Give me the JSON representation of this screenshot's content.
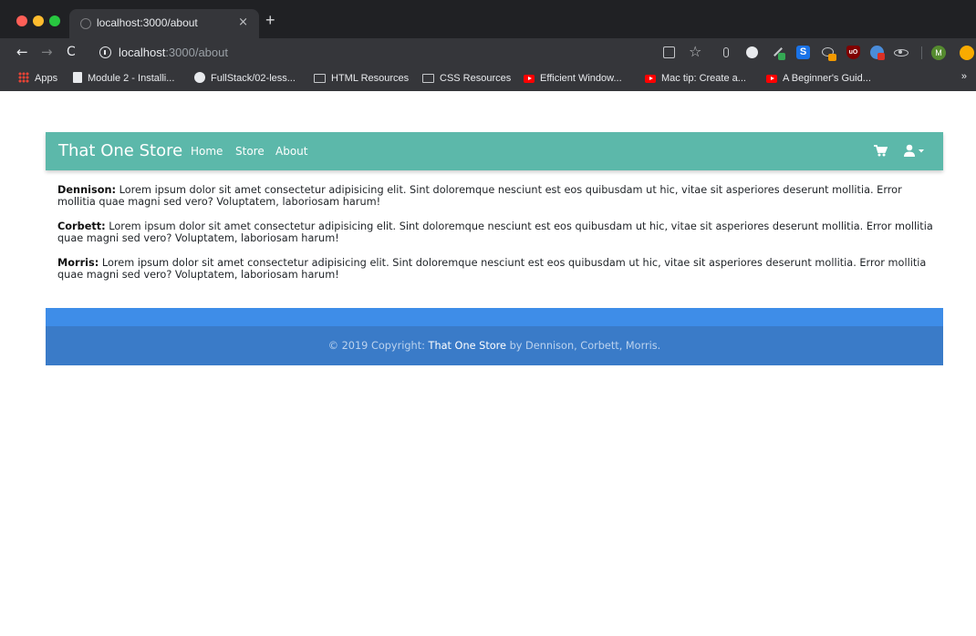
{
  "browser": {
    "tab_title": "localhost:3000/about",
    "tab_close": "×",
    "new_tab": "+",
    "url_host": "localhost",
    "url_path": ":3000/about",
    "profile_initial": "M",
    "ext_s_label": "S",
    "ext_ub_label": "uO"
  },
  "bookmarks": [
    {
      "label": "Apps",
      "icon": "apps-icon"
    },
    {
      "label": "Module 2 - Installi...",
      "icon": "document-icon"
    },
    {
      "label": "FullStack/02-less...",
      "icon": "github-icon"
    },
    {
      "label": "HTML Resources",
      "icon": "folder-icon"
    },
    {
      "label": "CSS Resources",
      "icon": "folder-icon"
    },
    {
      "label": "Efficient Window...",
      "icon": "youtube-icon"
    },
    {
      "label": "Mac tip: Create a...",
      "icon": "youtube-icon"
    },
    {
      "label": "A Beginner's Guid...",
      "icon": "youtube-icon"
    }
  ],
  "bookmarks_more": "»",
  "navbar": {
    "brand": "That One Store",
    "links": [
      "Home",
      "Store",
      "About"
    ],
    "bg_color": "#5cb8aa"
  },
  "content": {
    "paragraphs": [
      {
        "name": "Dennison:",
        "text": " Lorem ipsum dolor sit amet consectetur adipisicing elit. Sint doloremque nesciunt est eos quibusdam ut hic, vitae sit asperiores deserunt mollitia. Error mollitia quae magni sed vero? Voluptatem, laboriosam harum!"
      },
      {
        "name": "Corbett:",
        "text": " Lorem ipsum dolor sit amet consectetur adipisicing elit. Sint doloremque nesciunt est eos quibusdam ut hic, vitae sit asperiores deserunt mollitia. Error mollitia quae magni sed vero? Voluptatem, laboriosam harum!"
      },
      {
        "name": "Morris:",
        "text": " Lorem ipsum dolor sit amet consectetur adipisicing elit. Sint doloremque nesciunt est eos quibusdam ut hic, vitae sit asperiores deserunt mollitia. Error mollitia quae magni sed vero? Voluptatem, laboriosam harum!"
      }
    ]
  },
  "footer": {
    "prefix": "© 2019 Copyright: ",
    "brand": "That One Store",
    "suffix": " by Dennison, Corbett, Morris.",
    "top_color": "#3e8de8",
    "bottom_color": "#3a7bc8"
  }
}
